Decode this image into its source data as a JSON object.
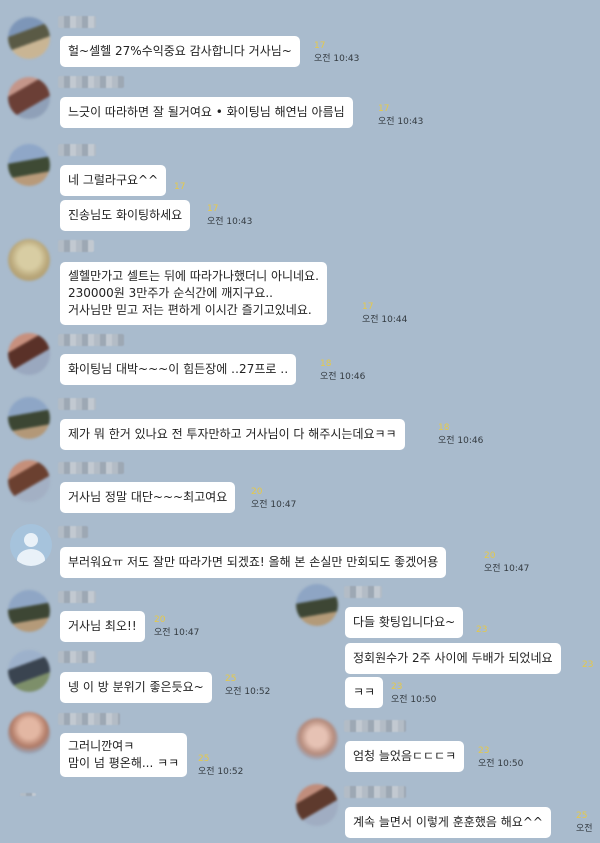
{
  "messages": [
    {
      "text": [
        "헐~셀헬 27%수익중요 감사합니다 거사님~"
      ],
      "unread": "17",
      "time": "오전 10:43"
    },
    {
      "text": [
        "느긋이 따라하면 잘 될거여요 • 화이팅님 해연님 아름님"
      ],
      "unread": "17",
      "time": "오전 10:43"
    },
    {
      "text": [
        "네 그럴라구요^^"
      ],
      "unread": "17",
      "time": ""
    },
    {
      "text": [
        "진송님도 화이팅하세요"
      ],
      "unread": "17",
      "time": "오전 10:43"
    },
    {
      "text": [
        "셀헬만가고  셀트는 뒤에 따라가나했더니  아니네요.",
        "230000원  3만주가  순식간에  깨지구요..",
        "거사님만 믿고 저는  편하게   이시간 즐기고있네요."
      ],
      "unread": "17",
      "time": "오전 10:44"
    },
    {
      "text": [
        "화이팅님 대박~~~이 힘든장에  ‥27프로 ‥"
      ],
      "unread": "18",
      "time": "오전 10:46"
    },
    {
      "text": [
        "제가 뭐 한거 있나요 전 투자만하고 거사님이 다 해주시는데요ㅋㅋ"
      ],
      "unread": "18",
      "time": "오전 10:46"
    },
    {
      "text": [
        "거사님  정말 대단~~~최고여요"
      ],
      "unread": "20",
      "time": "오전 10:47"
    },
    {
      "text": [
        "부러워요ㅠ 저도 잘만 따라가면 되겠죠! 올해 본 손실만 만회되도 좋겠어용"
      ],
      "unread": "20",
      "time": "오전 10:47"
    },
    {
      "text": [
        "거사님 최오!!"
      ],
      "unread": "20",
      "time": "오전 10:47"
    },
    {
      "text": [
        "넹 이 방 분위기 좋은듯요~"
      ],
      "unread": "25",
      "time": "오전 10:52"
    },
    {
      "text": [
        "그러니깐여ㅋ",
        "맘이 넘 평온해...  ㅋㅋ"
      ],
      "unread": "25",
      "time": "오전 10:52"
    },
    {
      "text": [
        "다들 홧팅입니다요~"
      ],
      "unread": "",
      "time": ""
    },
    {
      "text": [
        "정회원수가 2주 사이에 두배가 되었네요"
      ],
      "unread": "23",
      "time": ""
    },
    {
      "text": [
        "ㅋㅋ"
      ],
      "unread": "23",
      "time": "오전 10:50"
    },
    {
      "text": [
        "엄청 늘었음ㄷㄷㄷㅋ"
      ],
      "unread": "23",
      "time": "오전 10:50"
    },
    {
      "text": [
        "계속 늘면서  이렇게 훈훈했음  해요^^"
      ],
      "unread": "25",
      "time": "오전"
    }
  ],
  "colors": {
    "background": "#a9bbcd",
    "bubble": "#ffffff",
    "unread": "#e5c94a"
  }
}
